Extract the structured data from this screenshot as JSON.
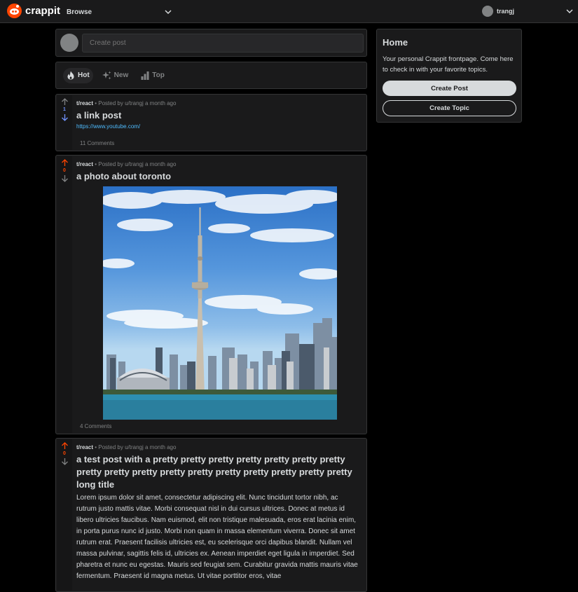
{
  "header": {
    "logo_text": "crappit",
    "browse_label": "Browse",
    "username": "trangj"
  },
  "create_post": {
    "placeholder": "Create post"
  },
  "sort_tabs": [
    {
      "label": "Hot",
      "active": true
    },
    {
      "label": "New",
      "active": false
    },
    {
      "label": "Top",
      "active": false
    }
  ],
  "posts": [
    {
      "subreddit": "t/react",
      "posted_by": "• Posted by u/trangj a month ago",
      "votes": "1",
      "title": "a link post",
      "link": "https://www.youtube.com/",
      "comments": "11 Comments"
    },
    {
      "subreddit": "t/react",
      "posted_by": "• Posted by u/trangj a month ago",
      "votes": "0",
      "title": "a photo about toronto",
      "comments": "4 Comments"
    },
    {
      "subreddit": "t/react",
      "posted_by": "• Posted by u/trangj a month ago",
      "votes": "0",
      "title": "a test post with a pretty pretty pretty pretty pretty pretty pretty pretty pretty pretty pretty pretty pretty pretty pretty pretty pretty long title",
      "body": "Lorem ipsum dolor sit amet, consectetur adipiscing elit. Nunc tincidunt tortor nibh, ac rutrum justo mattis vitae. Morbi consequat nisl in dui cursus ultrices. Donec at metus id libero ultricies faucibus. Nam euismod, elit non tristique malesuada, eros erat lacinia enim, in porta purus nunc id justo. Morbi non quam in massa elementum viverra. Donec sit amet rutrum erat. Praesent facilisis ultricies est, eu scelerisque orci dapibus blandit. Nullam vel massa pulvinar, sagittis felis id, ultricies ex. Aenean imperdiet eget ligula in imperdiet. Sed pharetra et nunc eu egestas. Mauris sed feugiat sem. Curabitur gravida mattis mauris vitae fermentum. Praesent id magna metus. Ut vitae porttitor eros, vitae"
    }
  ],
  "sidebar": {
    "title": "Home",
    "description": "Your personal Crappit frontpage. Come here to check in with your favorite topics.",
    "create_post_label": "Create Post",
    "create_topic_label": "Create Topic"
  },
  "colors": {
    "accent": "#ff4500",
    "upvote_active": "#ff4500",
    "vote_count_link": "#7193ff",
    "link": "#4fbcff"
  }
}
